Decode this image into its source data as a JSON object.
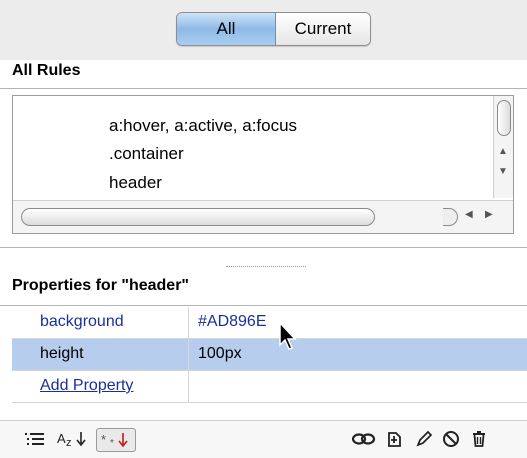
{
  "view_toggle": {
    "all_label": "All",
    "current_label": "Current",
    "selected": "All"
  },
  "all_rules": {
    "title": "All Rules",
    "items": [
      "a:hover, a:active, a:focus",
      ".container",
      "header"
    ]
  },
  "properties": {
    "title": "Properties for \"header\"",
    "rows": [
      {
        "name": "background",
        "value": "#AD896E"
      },
      {
        "name": "height",
        "value": "100px"
      }
    ],
    "add_label": "Add Property"
  },
  "toolbar": {
    "show_category_icon": "category-view-icon",
    "show_list_icon": "az-sort-icon",
    "show_set_icon": "set-properties-only-icon",
    "attach_icon": "attach-stylesheet-icon",
    "new_rule_icon": "new-css-rule-icon",
    "edit_icon": "edit-rule-icon",
    "disable_icon": "disable-property-icon",
    "delete_icon": "delete-rule-icon"
  },
  "colors": {
    "selection": "#b6cdee",
    "link": "#1a2f9c",
    "accent_red": "#c31a1a"
  }
}
